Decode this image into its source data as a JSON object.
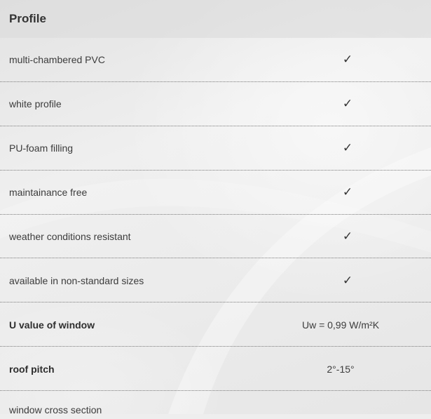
{
  "header": {
    "title": "Profile"
  },
  "check_glyph": "✓",
  "rows": [
    {
      "label": "multi-chambered PVC",
      "bold": false,
      "value": "",
      "checked": true
    },
    {
      "label": "white profile",
      "bold": false,
      "value": "",
      "checked": true
    },
    {
      "label": "PU-foam filling",
      "bold": false,
      "value": "",
      "checked": true
    },
    {
      "label": "maintainance free",
      "bold": false,
      "value": "",
      "checked": true
    },
    {
      "label": "weather conditions resistant",
      "bold": false,
      "value": "",
      "checked": true
    },
    {
      "label": "available in non-standard sizes",
      "bold": false,
      "value": "",
      "checked": true
    },
    {
      "label": "U value of window",
      "bold": true,
      "value": "Uw =  0,99 W/m²K",
      "checked": false
    },
    {
      "label": "roof pitch",
      "bold": true,
      "value": "2°-15°",
      "checked": false
    },
    {
      "label": "window cross section",
      "bold": false,
      "value": "",
      "checked": false
    }
  ],
  "colors": {
    "background": "#eeeeee",
    "header_background": "#dcdcdc",
    "text": "#3c3c3c",
    "divider": "#7a7a7a"
  }
}
